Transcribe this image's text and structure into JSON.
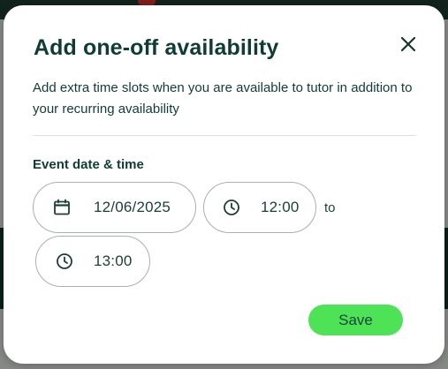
{
  "dialog": {
    "title": "Add one-off availability",
    "description": "Add extra time slots when you are available to tutor in addition to your recurring availability",
    "section_label": "Event date & time",
    "date": {
      "value": "12/06/2025",
      "icon": "calendar-icon"
    },
    "start_time": {
      "value": "12:00",
      "icon": "clock-icon"
    },
    "separator_label": "to",
    "end_time": {
      "value": "13:00",
      "icon": "clock-icon"
    },
    "save_label": "Save",
    "close_icon": "close-icon"
  },
  "colors": {
    "title": "#0f3d33",
    "text": "#113c33",
    "accent_button": "#4ee357",
    "border": "#a9b0ad",
    "overlay": "rgba(0,0,0,0.42)"
  }
}
